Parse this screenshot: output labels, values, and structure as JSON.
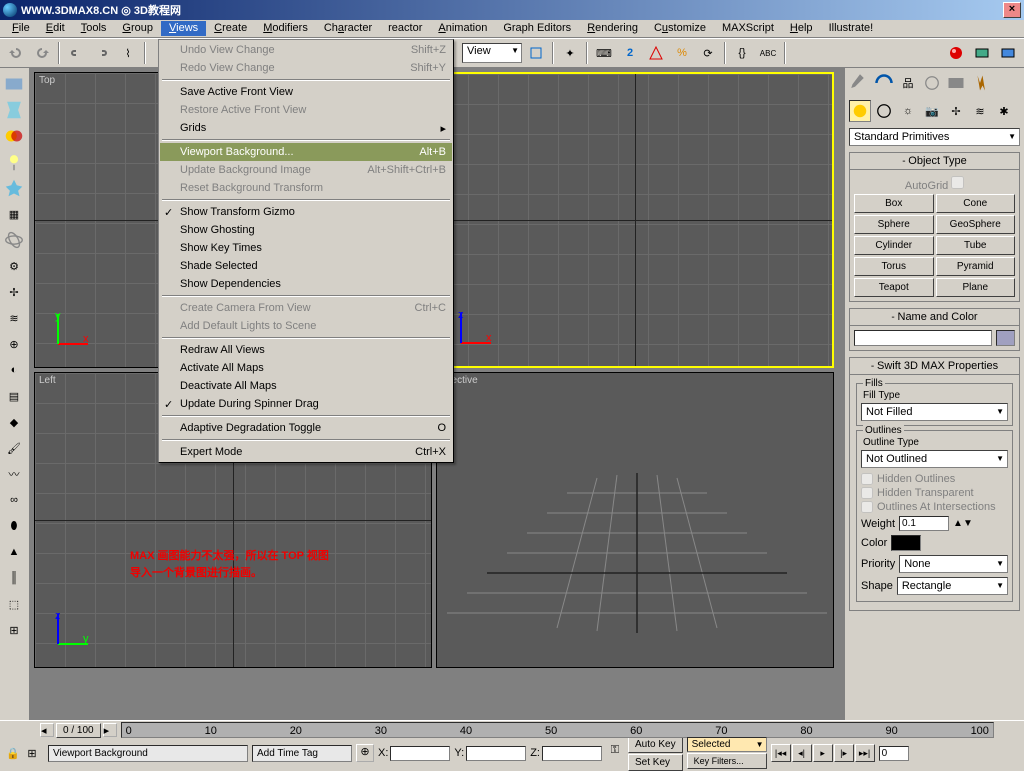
{
  "titlebar": {
    "url": "WWW.3DMAX8.CN",
    "site": "3D教程网"
  },
  "menubar": [
    "File",
    "Edit",
    "Tools",
    "Group",
    "Views",
    "Create",
    "Modifiers",
    "Character",
    "reactor",
    "Animation",
    "Graph Editors",
    "Rendering",
    "Customize",
    "MAXScript",
    "Help",
    "Illustrate!"
  ],
  "active_menu_index": 4,
  "toolbar": {
    "view_selector": "View"
  },
  "views_menu": {
    "groups": [
      [
        {
          "label": "Undo View Change",
          "shortcut": "Shift+Z",
          "disabled": true
        },
        {
          "label": "Redo View Change",
          "shortcut": "Shift+Y",
          "disabled": true
        }
      ],
      [
        {
          "label": "Save Active Front View"
        },
        {
          "label": "Restore Active Front View",
          "disabled": true
        },
        {
          "label": "Grids",
          "submenu": true
        }
      ],
      [
        {
          "label": "Viewport Background...",
          "shortcut": "Alt+B",
          "highlight": true
        },
        {
          "label": "Update Background Image",
          "shortcut": "Alt+Shift+Ctrl+B",
          "disabled": true
        },
        {
          "label": "Reset Background Transform",
          "disabled": true
        }
      ],
      [
        {
          "label": "Show Transform Gizmo",
          "checked": true
        },
        {
          "label": "Show Ghosting"
        },
        {
          "label": "Show Key Times"
        },
        {
          "label": "Shade Selected"
        },
        {
          "label": "Show Dependencies"
        }
      ],
      [
        {
          "label": "Create Camera From View",
          "shortcut": "Ctrl+C",
          "disabled": true
        },
        {
          "label": "Add Default Lights to Scene",
          "disabled": true
        }
      ],
      [
        {
          "label": "Redraw All Views"
        },
        {
          "label": "Activate All Maps"
        },
        {
          "label": "Deactivate All Maps"
        },
        {
          "label": "Update During Spinner Drag",
          "checked": true
        }
      ],
      [
        {
          "label": "Adaptive Degradation Toggle",
          "shortcut": "O"
        }
      ],
      [
        {
          "label": "Expert Mode",
          "shortcut": "Ctrl+X"
        }
      ]
    ]
  },
  "viewports": {
    "top": "Top",
    "front": "nt",
    "left": "Left",
    "perspective": "spective"
  },
  "annotation": {
    "line1": "MAX 画图能力不太强，所以在 TOP 视图",
    "line2": "导入一个背景图进行描画。"
  },
  "command_panel": {
    "category": "Standard Primitives",
    "object_type_title": "Object Type",
    "autogrid": "AutoGrid",
    "buttons": [
      "Box",
      "Cone",
      "Sphere",
      "GeoSphere",
      "Cylinder",
      "Tube",
      "Torus",
      "Pyramid",
      "Teapot",
      "Plane"
    ],
    "name_color_title": "Name and Color",
    "swift3d_title": "Swift 3D MAX Properties",
    "fills": {
      "title": "Fills",
      "fill_type_label": "Fill Type",
      "fill_type": "Not Filled"
    },
    "outlines": {
      "title": "Outlines",
      "type_label": "Outline Type",
      "type": "Not Outlined",
      "hidden_outlines": "Hidden Outlines",
      "hidden_transparent": "Hidden Transparent",
      "at_intersections": "Outlines At Intersections",
      "weight_label": "Weight",
      "weight": "0.1",
      "color_label": "Color",
      "priority_label": "Priority",
      "priority": "None",
      "shape_label": "Shape",
      "shape": "Rectangle"
    }
  },
  "timeline": {
    "slider": "0 / 100",
    "ticks": [
      "0",
      "10",
      "20",
      "30",
      "40",
      "50",
      "60",
      "70",
      "80",
      "90",
      "100"
    ]
  },
  "status": {
    "x_label": "X:",
    "y_label": "Y:",
    "z_label": "Z:",
    "autokey": "Auto Key",
    "setkey": "Set Key",
    "selected": "Selected",
    "keyfilters": "Key Filters...",
    "prompt": "Viewport Background",
    "add_time_tag": "Add Time Tag",
    "frame": "0"
  },
  "colors": {
    "highlight": "#8a9a5b",
    "annotation": "#ef0000",
    "active_border": "#ffff00"
  }
}
